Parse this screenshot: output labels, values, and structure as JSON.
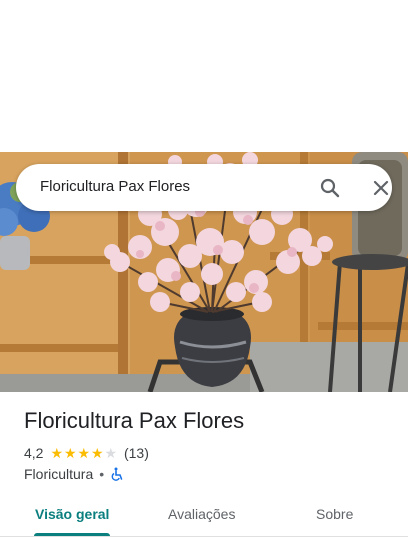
{
  "search": {
    "query": "Floricultura Pax Flores"
  },
  "place": {
    "name": "Floricultura Pax Flores",
    "rating": "4,2",
    "rating_stars": 4.2,
    "review_count": "(13)",
    "category": "Floricultura",
    "separator": "•"
  },
  "tabs": [
    {
      "label": "Visão geral",
      "active": true
    },
    {
      "label": "Avaliações",
      "active": false
    },
    {
      "label": "Sobre",
      "active": false
    }
  ],
  "colors": {
    "accent": "#0b7e7e",
    "star": "#fbbc04",
    "accessibility": "#1a73e8"
  },
  "icons": {
    "search": "search-icon",
    "close": "close-icon",
    "accessibility": "wheelchair-icon"
  }
}
